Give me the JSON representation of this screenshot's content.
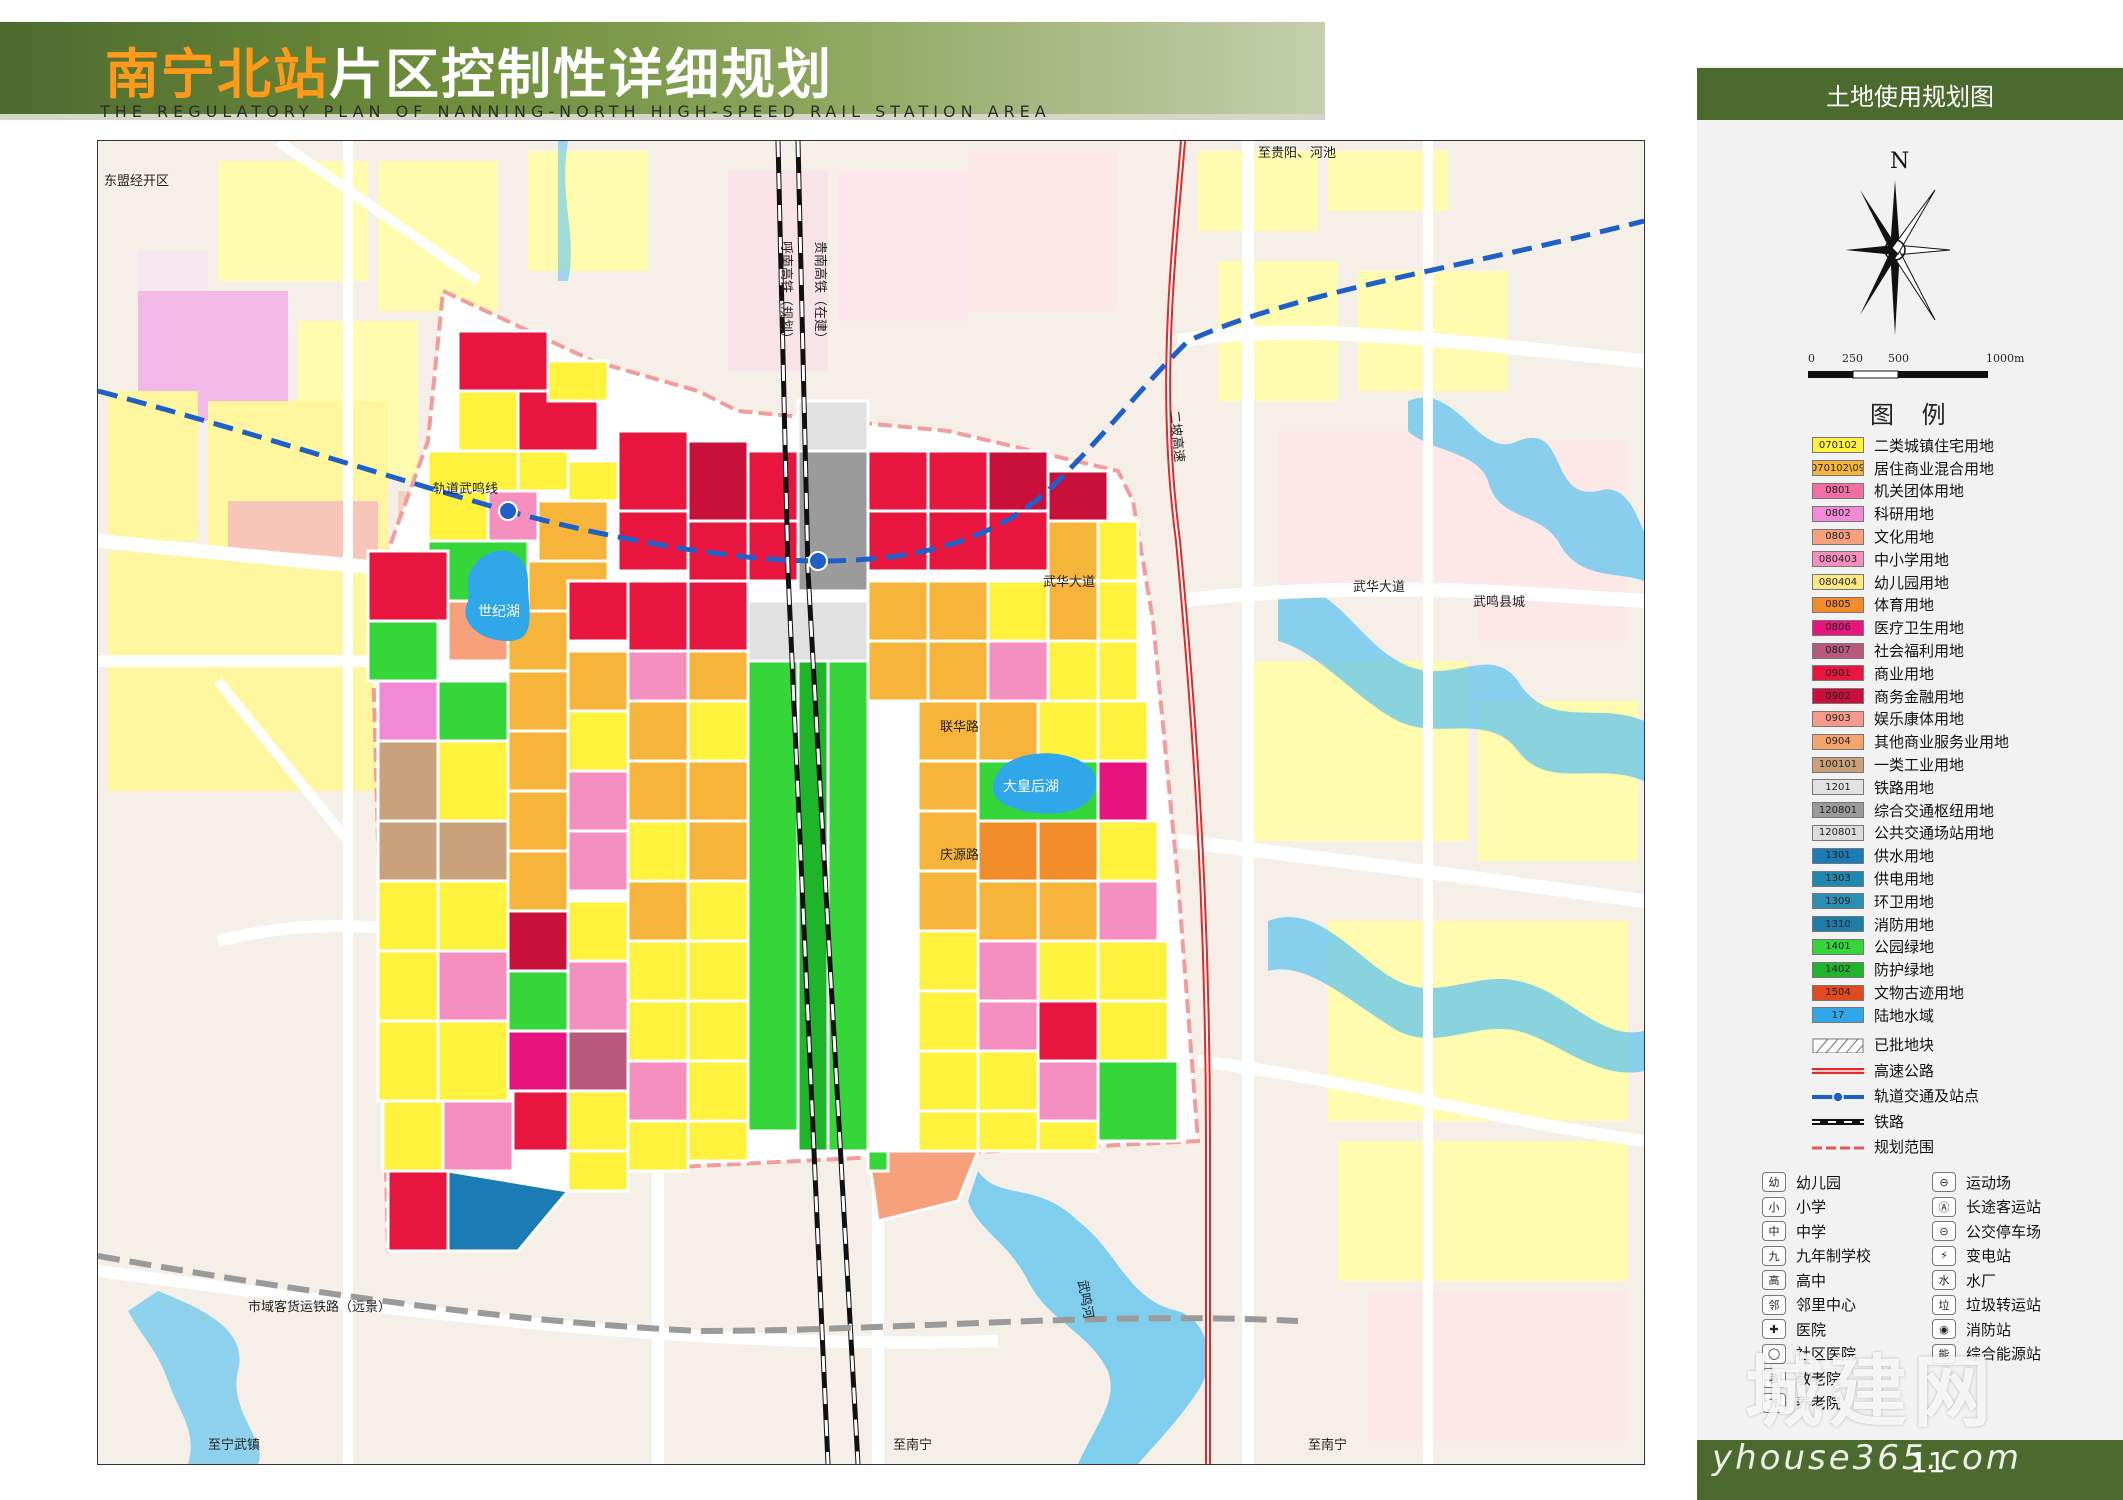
{
  "header": {
    "title_highlight": "南宁北站",
    "title_rest": "片区控制性详细规划",
    "subtitle_en": "THE REGULATORY PLAN OF NANNING-NORTH HIGH-SPEED RAIL STATION AREA"
  },
  "panel": {
    "heading": "土地使用规划图",
    "north_label": "N",
    "scale": {
      "ticks": [
        "0",
        "250",
        "500",
        "1000m"
      ]
    },
    "legend_title": "图 例"
  },
  "legend": [
    {
      "code": "070102",
      "label": "二类城镇住宅用地",
      "color": "#fff23c"
    },
    {
      "code": "070102\\09",
      "label": "居住商业混合用地",
      "color": "#f7b43a"
    },
    {
      "code": "0801",
      "label": "机关团体用地",
      "color": "#f26fa4"
    },
    {
      "code": "0802",
      "label": "科研用地",
      "color": "#f08ad6"
    },
    {
      "code": "0803",
      "label": "文化用地",
      "color": "#f6a07c"
    },
    {
      "code": "080403",
      "label": "中小学用地",
      "color": "#f48fbf"
    },
    {
      "code": "080404",
      "label": "幼儿园用地",
      "color": "#fde983"
    },
    {
      "code": "0805",
      "label": "体育用地",
      "color": "#f28b2a"
    },
    {
      "code": "0806",
      "label": "医疗卫生用地",
      "color": "#e8147e"
    },
    {
      "code": "0807",
      "label": "社会福利用地",
      "color": "#b7587c"
    },
    {
      "code": "0901",
      "label": "商业用地",
      "color": "#e8163f"
    },
    {
      "code": "0902",
      "label": "商务金融用地",
      "color": "#c8103b"
    },
    {
      "code": "0903",
      "label": "娱乐康体用地",
      "color": "#f69a8c"
    },
    {
      "code": "0904",
      "label": "其他商业服务业用地",
      "color": "#f4a56c"
    },
    {
      "code": "100101",
      "label": "一类工业用地",
      "color": "#c9a27c"
    },
    {
      "code": "1201",
      "label": "铁路用地",
      "color": "#e1e1e1"
    },
    {
      "code": "120801",
      "label": "综合交通枢纽用地",
      "color": "#9b9b9b"
    },
    {
      "code": "120801",
      "label": "公共交通场站用地",
      "color": "#dcdcdc"
    },
    {
      "code": "1301",
      "label": "供水用地",
      "color": "#1b7bb4"
    },
    {
      "code": "1303",
      "label": "供电用地",
      "color": "#1f88b0"
    },
    {
      "code": "1309",
      "label": "环卫用地",
      "color": "#2b8fb4"
    },
    {
      "code": "1310",
      "label": "消防用地",
      "color": "#1c7ea8"
    },
    {
      "code": "1401",
      "label": "公园绿地",
      "color": "#35d63a"
    },
    {
      "code": "1402",
      "label": "防护绿地",
      "color": "#1eb52a"
    },
    {
      "code": "1504",
      "label": "文物古迹用地",
      "color": "#e04a1c"
    },
    {
      "code": "17",
      "label": "陆地水域",
      "color": "#2fa7e8"
    }
  ],
  "legend_lines": [
    {
      "label": "已批地块",
      "kind": "hatch"
    },
    {
      "label": "高速公路",
      "kind": "highway"
    },
    {
      "label": "轨道交通及站点",
      "kind": "metro"
    },
    {
      "label": "铁路",
      "kind": "rail"
    },
    {
      "label": "规划范围",
      "kind": "boundary"
    }
  ],
  "facility_icons": [
    [
      "幼儿园",
      "运动场"
    ],
    [
      "小学",
      "长途客运站"
    ],
    [
      "中学",
      "公交停车场"
    ],
    [
      "九年制学校",
      "变电站"
    ],
    [
      "高中",
      "水厂"
    ],
    [
      "邻里中心",
      "垃圾转运站"
    ],
    [
      "医院",
      "消防站"
    ],
    [
      "社区医院",
      "综合能源站"
    ],
    [
      "敬老院",
      ""
    ],
    [
      "养老院",
      ""
    ]
  ],
  "facility_glyphs": [
    [
      "幼",
      "⊖"
    ],
    [
      "小",
      "Ⓐ"
    ],
    [
      "中",
      "⊝"
    ],
    [
      "九",
      "⚡"
    ],
    [
      "高",
      "水"
    ],
    [
      "邻",
      "垃"
    ],
    [
      "✚",
      "◉"
    ],
    [
      "◯",
      "能"
    ],
    [
      "敬",
      ""
    ],
    [
      "养",
      ""
    ]
  ],
  "map_labels": {
    "dongmeng": "东盟经开区",
    "guidaowuming": "轨道武鸣线",
    "shijihu": "世纪湖",
    "dahuanghouhu": "大皇后湖",
    "zhiguiyang": "至贵阳、河池",
    "wumingxiancheng": "武鸣县城",
    "zhinanning1": "至南宁",
    "zhinanning2": "至南宁",
    "zhiwuming": "至宁武镇",
    "shiyuke": "市域客货运铁路（远景）",
    "huhe": "呼南高铁（规划）",
    "guinan": "贵南高铁（在建）",
    "ercheng": "二坡高速",
    "wuhua": "武华大道",
    "wuming_river": "武鸣河",
    "wuhua2": "武华大道",
    "lianhua": "联华路",
    "qingyuan": "庆源路"
  },
  "page": {
    "number": "11"
  },
  "watermark": {
    "text": "城建网",
    "url": "yhouse365.com"
  }
}
